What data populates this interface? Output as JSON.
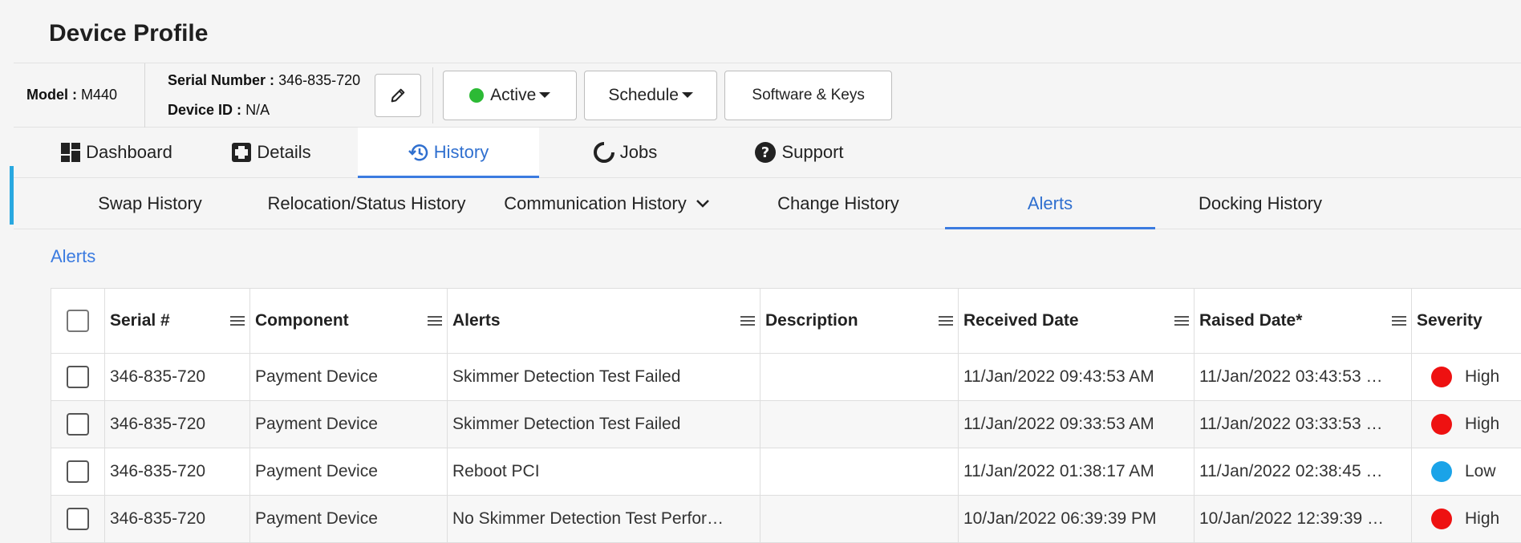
{
  "page": {
    "title": "Device Profile"
  },
  "device": {
    "model_label": "Model :",
    "model_value": "M440",
    "serial_label": "Serial Number :",
    "serial_value": "346-835-720",
    "deviceid_label": "Device ID :",
    "deviceid_value": "N/A"
  },
  "toolbar": {
    "status_label": "Active",
    "status_color": "#2cba35",
    "schedule_label": "Schedule",
    "software_label": "Software & Keys"
  },
  "main_tabs": [
    {
      "label": "Dashboard",
      "icon": "dashboard-icon"
    },
    {
      "label": "Details",
      "icon": "details-icon"
    },
    {
      "label": "History",
      "icon": "history-icon",
      "active": true
    },
    {
      "label": "Jobs",
      "icon": "jobs-icon"
    },
    {
      "label": "Support",
      "icon": "support-icon"
    }
  ],
  "sub_tabs": [
    {
      "label": "Swap History"
    },
    {
      "label": "Relocation/Status History"
    },
    {
      "label": "Communication History"
    },
    {
      "label": "Change History"
    },
    {
      "label": "Alerts",
      "active": true
    },
    {
      "label": "Docking History"
    }
  ],
  "section": {
    "label": "Alerts"
  },
  "table": {
    "columns": [
      "Serial #",
      "Component",
      "Alerts",
      "Description",
      "Received Date",
      "Raised Date*",
      "Severity"
    ],
    "rows": [
      {
        "serial": "346-835-720",
        "component": "Payment Device",
        "alert": "Skimmer Detection Test Failed",
        "description": "",
        "received": "11/Jan/2022 09:43:53 AM",
        "raised": "11/Jan/2022 03:43:53 …",
        "severity": "High",
        "severity_color": "#ee1111"
      },
      {
        "serial": "346-835-720",
        "component": "Payment Device",
        "alert": "Skimmer Detection Test Failed",
        "description": "",
        "received": "11/Jan/2022 09:33:53 AM",
        "raised": "11/Jan/2022 03:33:53 …",
        "severity": "High",
        "severity_color": "#ee1111"
      },
      {
        "serial": "346-835-720",
        "component": "Payment Device",
        "alert": "Reboot PCI",
        "description": "",
        "received": "11/Jan/2022 01:38:17 AM",
        "raised": "11/Jan/2022 02:38:45 …",
        "severity": "Low",
        "severity_color": "#1aa3e8"
      },
      {
        "serial": "346-835-720",
        "component": "Payment Device",
        "alert": "No Skimmer Detection Test Perfor…",
        "description": "",
        "received": "10/Jan/2022 06:39:39 PM",
        "raised": "10/Jan/2022 12:39:39 …",
        "severity": "High",
        "severity_color": "#ee1111"
      }
    ]
  }
}
